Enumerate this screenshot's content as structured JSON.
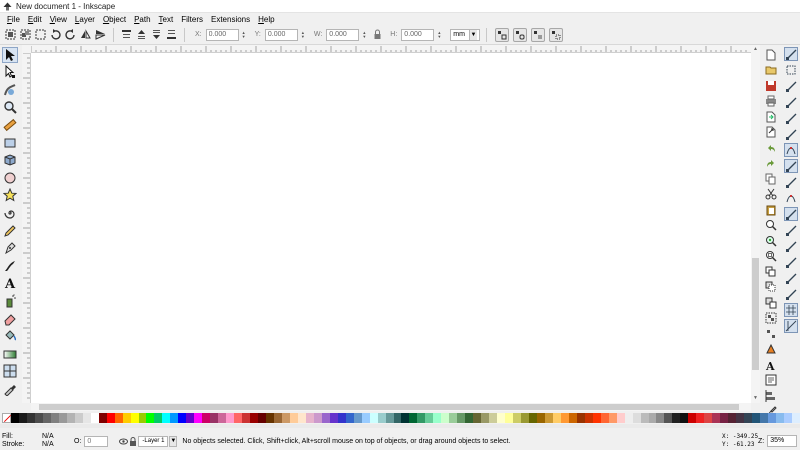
{
  "window": {
    "title": "New document 1 - Inkscape"
  },
  "menu": [
    {
      "u": "F",
      "rest": "ile"
    },
    {
      "u": "E",
      "rest": "dit"
    },
    {
      "u": "V",
      "rest": "iew"
    },
    {
      "u": "L",
      "rest": "ayer"
    },
    {
      "u": "O",
      "rest": "bject"
    },
    {
      "u": "P",
      "rest": "ath"
    },
    {
      "u": "T",
      "rest": "ext"
    },
    {
      "u": "",
      "rest": "Filters"
    },
    {
      "u": "",
      "rest": "Extensions"
    },
    {
      "u": "H",
      "rest": "elp"
    }
  ],
  "toolbar": {
    "x_label": "X:",
    "x_value": "0.000",
    "y_label": "Y:",
    "y_value": "0.000",
    "w_label": "W:",
    "w_value": "0.000",
    "h_label": "H:",
    "h_value": "0.000",
    "unit": "mm"
  },
  "status": {
    "fill_label": "Fill:",
    "fill_value": "N/A",
    "stroke_label": "Stroke:",
    "stroke_value": "N/A",
    "opacity_label": "O:",
    "opacity_value": "0",
    "layer": "-Layer 1",
    "message": "No objects selected. Click, Shift+click, Alt+scroll mouse on top of objects, or drag around objects to select.",
    "x_coord": "X: -349.25",
    "y_coord": "Y:  -61.23",
    "zoom_label": "Z:",
    "zoom_value": "35%"
  },
  "icons": {
    "tools": [
      "selector-tool-icon",
      "node-tool-icon",
      "tweak-tool-icon",
      "zoom-tool-icon",
      "measure-tool-icon",
      "rectangle-tool-icon",
      "3d-box-tool-icon",
      "ellipse-tool-icon",
      "star-tool-icon",
      "spiral-tool-icon",
      "pencil-tool-icon",
      "pen-tool-icon",
      "calligraphy-tool-icon",
      "text-tool-icon",
      "spray-tool-icon",
      "eraser-tool-icon",
      "paint-bucket-tool-icon",
      "gradient-tool-icon",
      "mesh-tool-icon",
      "dropper-tool-icon"
    ],
    "commands": [
      "new-document-icon",
      "open-file-icon",
      "save-icon",
      "print-icon",
      "import-icon",
      "export-icon",
      "undo-icon",
      "redo-icon",
      "copy-icon",
      "cut-icon",
      "paste-icon",
      "zoom-selection-icon",
      "zoom-drawing-icon",
      "zoom-page-icon",
      "duplicate-icon",
      "clone-icon",
      "unlink-clone-icon",
      "group-icon",
      "ungroup-icon",
      "fill-stroke-icon",
      "text-font-icon",
      "xml-editor-icon",
      "align-distribute-icon",
      "preferences-icon"
    ]
  },
  "palette": [
    "#000000",
    "#1a1a1a",
    "#333333",
    "#4d4d4d",
    "#666666",
    "#808080",
    "#999999",
    "#b3b3b3",
    "#cccccc",
    "#e6e6e6",
    "#ffffff",
    "#800000",
    "#ff0000",
    "#ff6600",
    "#ffcc00",
    "#ffff00",
    "#99cc00",
    "#00ff00",
    "#00cc66",
    "#00ffff",
    "#0099ff",
    "#0000ff",
    "#6600cc",
    "#ff00ff",
    "#cc0066",
    "#993366",
    "#cc6699",
    "#ff99cc",
    "#ff6666",
    "#cc3333",
    "#990000",
    "#660000",
    "#663300",
    "#996633",
    "#cc9966",
    "#ffcc99",
    "#ffe6cc",
    "#e6b3cc",
    "#cc99cc",
    "#9966cc",
    "#6633cc",
    "#3333cc",
    "#3366cc",
    "#6699cc",
    "#99ccff",
    "#ccffff",
    "#99cccc",
    "#669999",
    "#336666",
    "#003333",
    "#006633",
    "#339966",
    "#66cc99",
    "#99ffcc",
    "#ccffcc",
    "#99cc99",
    "#669966",
    "#336633",
    "#666633",
    "#999966",
    "#cccc99",
    "#ffffcc",
    "#ffff99",
    "#cccc66",
    "#999933",
    "#666600",
    "#996600",
    "#cc9933",
    "#ffcc66",
    "#ff9933",
    "#cc6600",
    "#993300",
    "#cc3300",
    "#ff3300",
    "#ff6633",
    "#ff9966",
    "#ffcccc",
    "#eeeeee",
    "#dddddd",
    "#bbbbbb",
    "#aaaaaa",
    "#888888",
    "#555555",
    "#222222",
    "#111111",
    "#cc0000",
    "#ee2222",
    "#dd4444",
    "#aa3355",
    "#772244",
    "#552233",
    "#443344",
    "#334455",
    "#225577",
    "#4477aa",
    "#6699dd",
    "#88bbee",
    "#aaccff",
    "#ddeeff"
  ]
}
